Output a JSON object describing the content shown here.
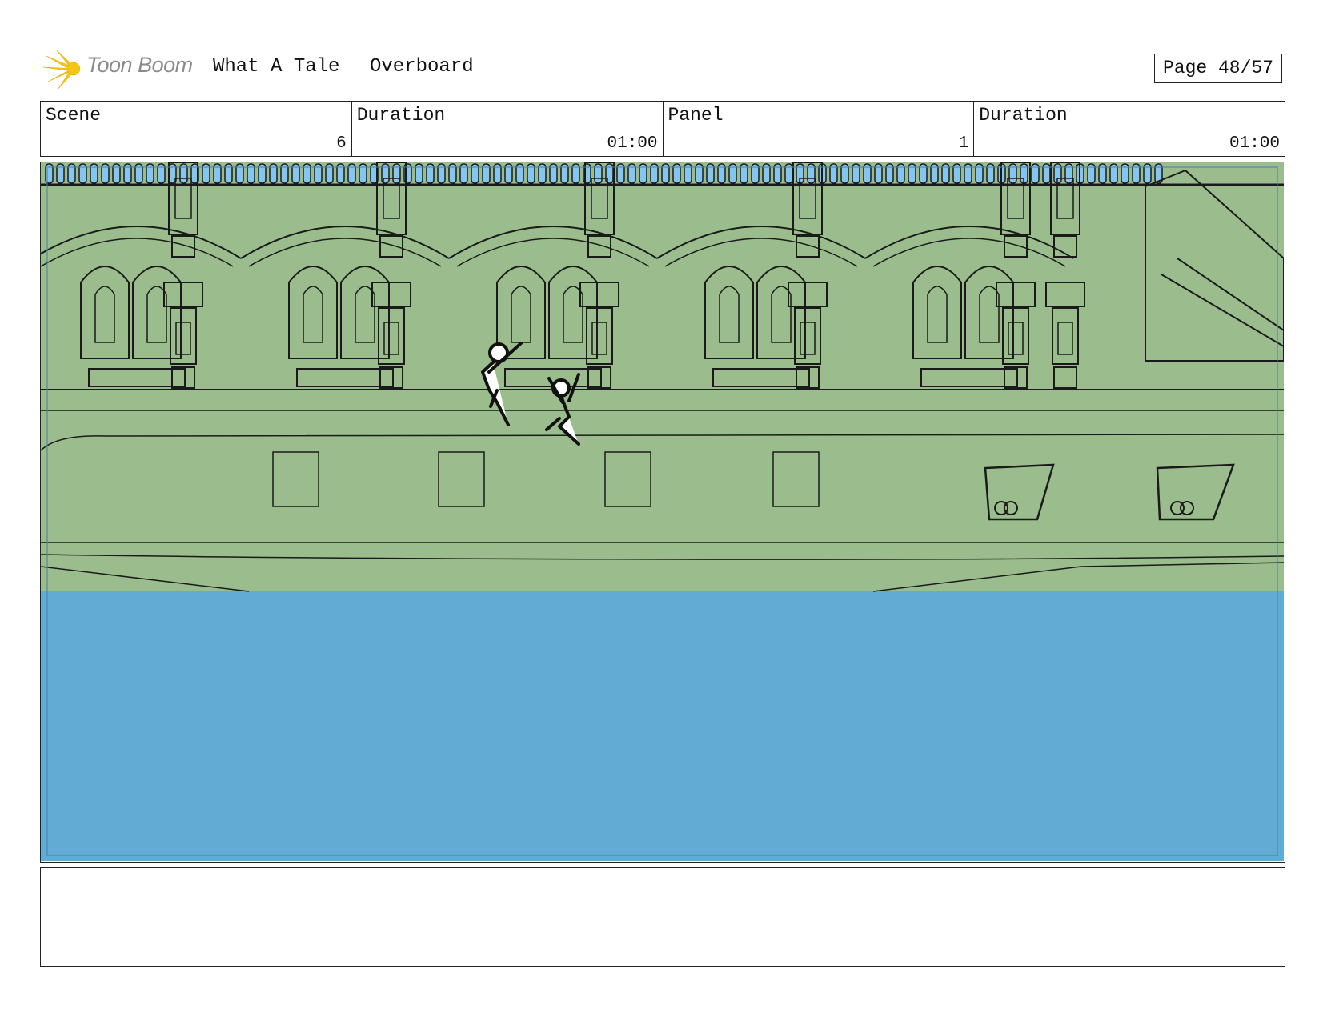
{
  "header": {
    "logo_text": "Toon Boom",
    "project_title": "What A Tale",
    "sequence_title": "Overboard",
    "page_label": "Page 48/57"
  },
  "info": {
    "scene_label": "Scene",
    "scene_value": "6",
    "scene_duration_label": "Duration",
    "scene_duration_value": "01:00",
    "panel_label": "Panel",
    "panel_value": "1",
    "panel_duration_label": "Duration",
    "panel_duration_value": "01:00"
  },
  "colors": {
    "ship_hull": "#9bbd8d",
    "water": "#62abd5",
    "sky": "#84c6ef",
    "line": "#1a1a1a",
    "logo_yellow": "#f5c518"
  },
  "notes": {
    "text": ""
  }
}
